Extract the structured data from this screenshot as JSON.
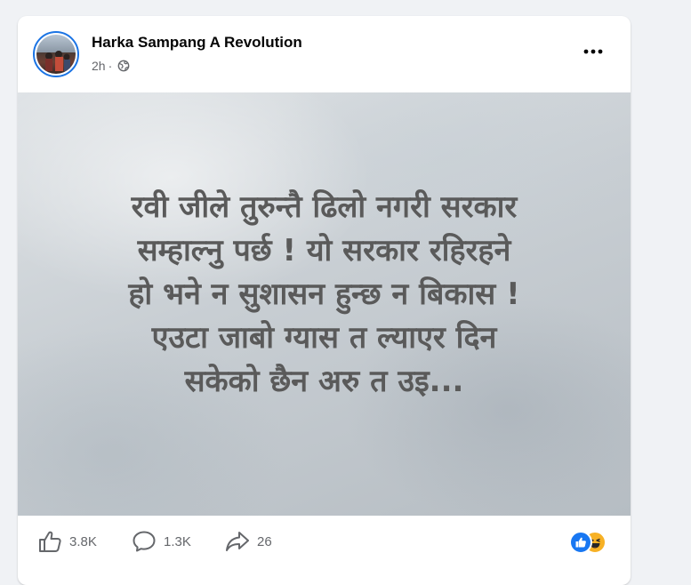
{
  "post": {
    "page_name": "Harka Sampang A Revolution",
    "time_ago": "2h",
    "separator": "·",
    "privacy_icon": "globe-icon",
    "more_icon": "more-horizontal-icon"
  },
  "image_text": {
    "lines": [
      "रवी जीले तुरुन्तै ढिलो नगरी सरकार",
      "सम्हाल्नु पर्छ ! यो सरकार रहिरहने",
      "हो भने न सुशासन हुन्छ न बिकास !",
      "एउटा जाबो ग्यास त ल्याएर दिन",
      "सकेको छैन अरु त उइ..."
    ],
    "text_color": "#5a5a5a"
  },
  "engagement": {
    "likes": "3.8K",
    "comments": "1.3K",
    "shares": "26",
    "reactions": [
      "like-reaction-icon",
      "haha-reaction-icon"
    ],
    "accent_color": "#1877f2"
  }
}
